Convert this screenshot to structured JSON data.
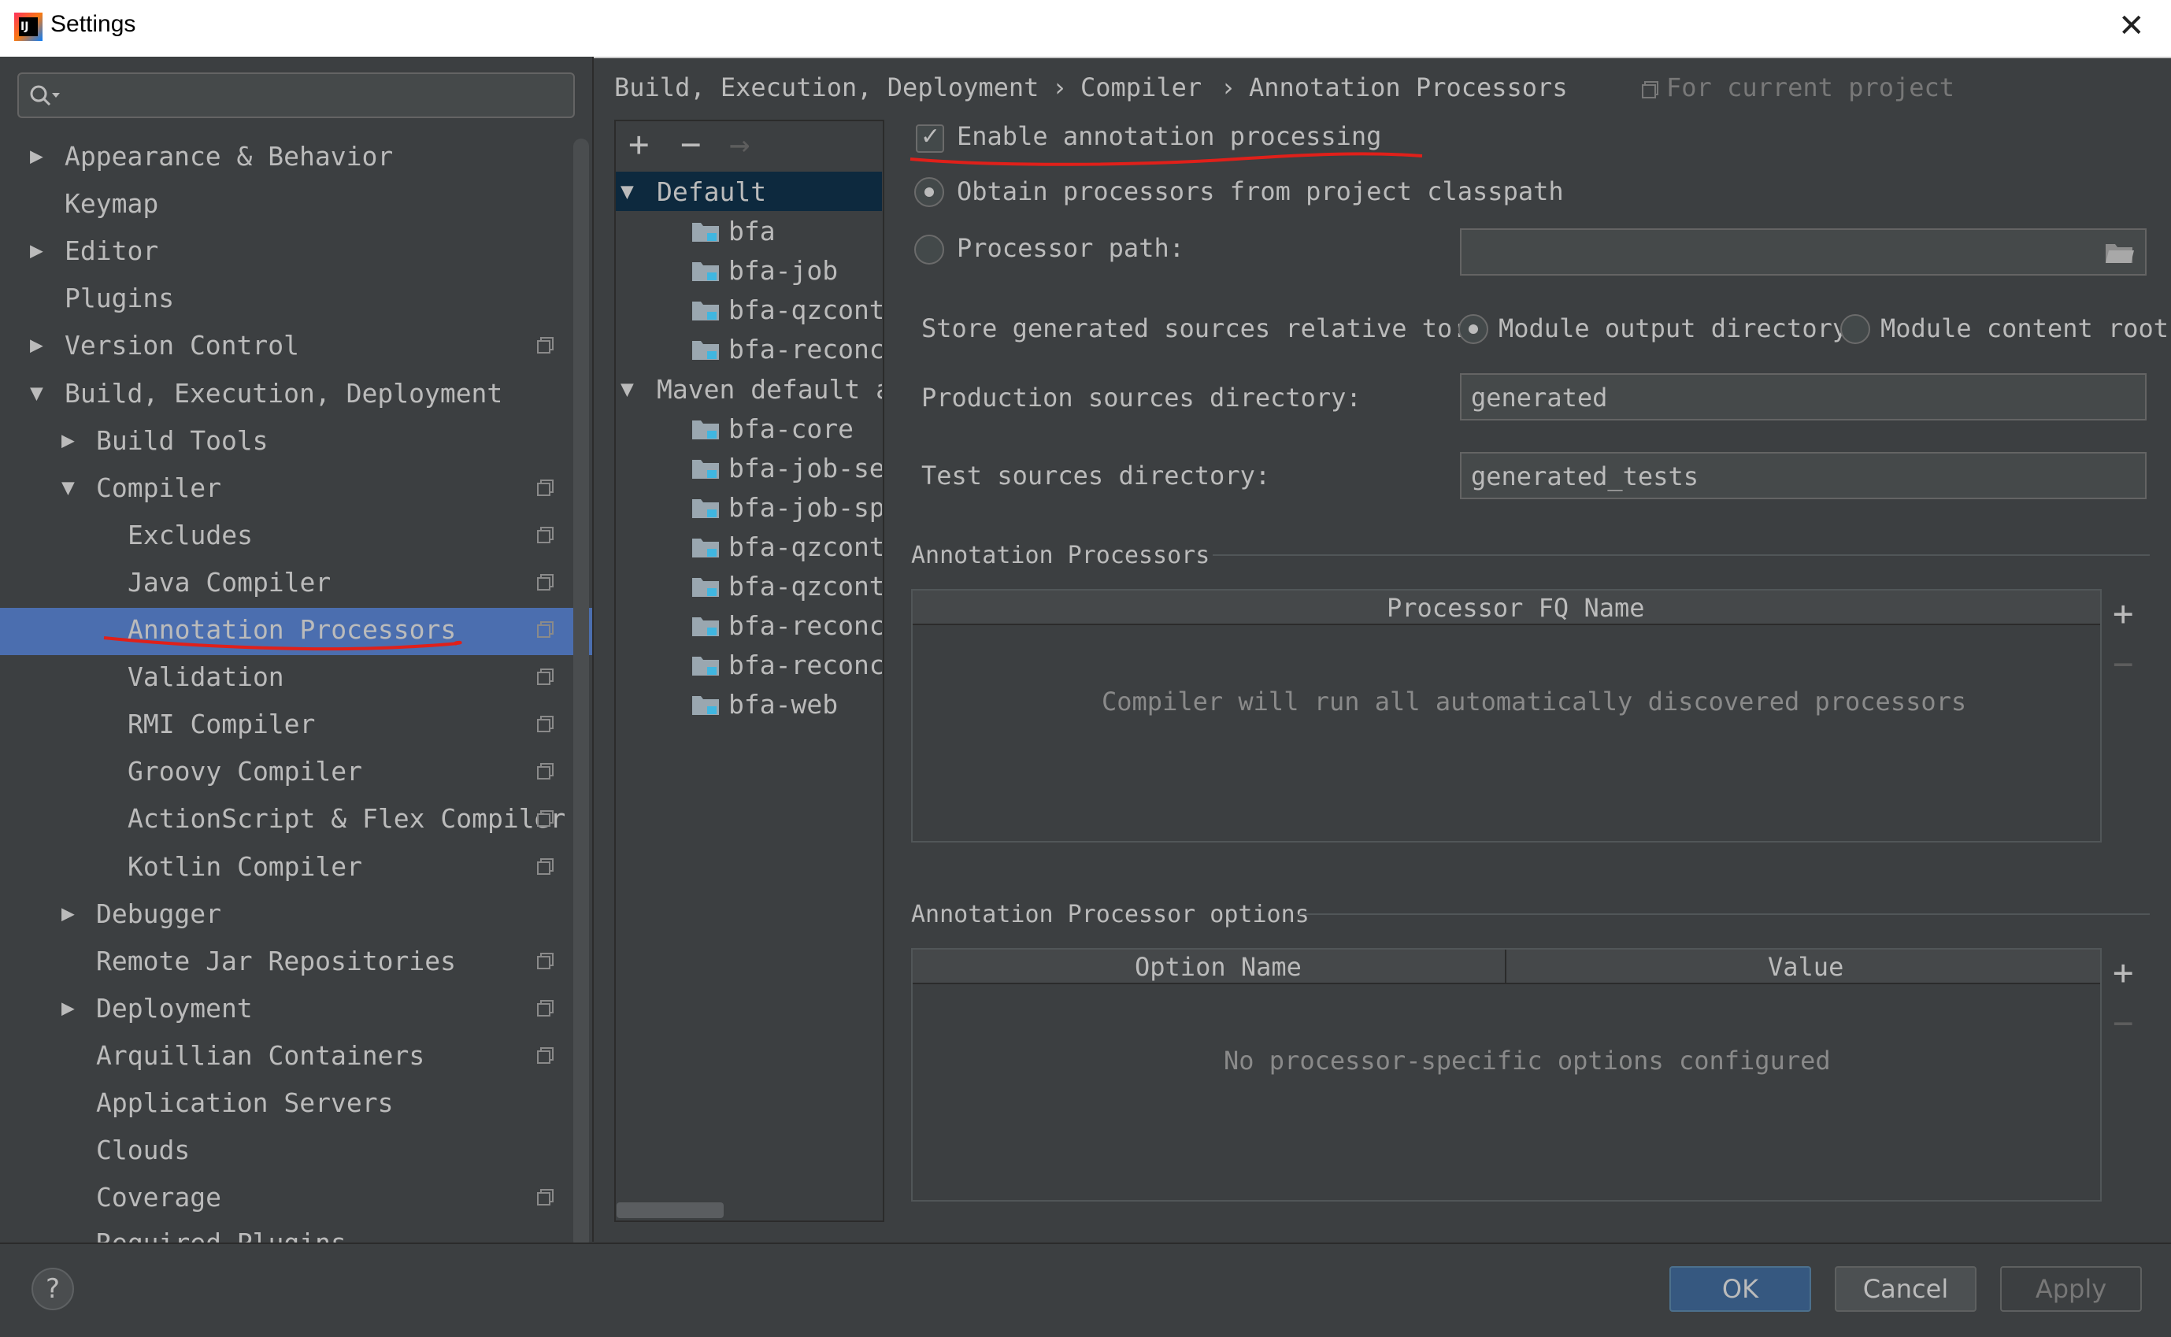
{
  "window": {
    "title": "Settings",
    "close": "✕"
  },
  "search": {
    "placeholder": ""
  },
  "sidebar": {
    "items": [
      {
        "label": "Appearance & Behavior",
        "arrow": "▶"
      },
      {
        "label": "Keymap"
      },
      {
        "label": "Editor",
        "arrow": "▶"
      },
      {
        "label": "Plugins"
      },
      {
        "label": "Version Control",
        "arrow": "▶"
      },
      {
        "label": "Build, Execution, Deployment",
        "arrow": "▼"
      },
      {
        "label": "Build Tools",
        "arrow": "▶"
      },
      {
        "label": "Compiler",
        "arrow": "▼"
      },
      {
        "label": "Excludes"
      },
      {
        "label": "Java Compiler"
      },
      {
        "label": "Annotation Processors"
      },
      {
        "label": "Validation"
      },
      {
        "label": "RMI Compiler"
      },
      {
        "label": "Groovy Compiler"
      },
      {
        "label": "ActionScript & Flex Compiler"
      },
      {
        "label": "Kotlin Compiler"
      },
      {
        "label": "Debugger",
        "arrow": "▶"
      },
      {
        "label": "Remote Jar Repositories"
      },
      {
        "label": "Deployment",
        "arrow": "▶"
      },
      {
        "label": "Arquillian Containers"
      },
      {
        "label": "Application Servers"
      },
      {
        "label": "Clouds"
      },
      {
        "label": "Coverage"
      },
      {
        "label": "Required Plugins"
      }
    ]
  },
  "profiles": {
    "toolbar": {
      "add": "+",
      "remove": "−",
      "move": "→"
    },
    "items": [
      {
        "label": "Default",
        "arrow": "▼"
      },
      {
        "label": "bfa"
      },
      {
        "label": "bfa-job"
      },
      {
        "label": "bfa-qzcontr"
      },
      {
        "label": "bfa-reconci"
      },
      {
        "label": "Maven default an",
        "arrow": "▼"
      },
      {
        "label": "bfa-core"
      },
      {
        "label": "bfa-job-ser"
      },
      {
        "label": "bfa-job-spi"
      },
      {
        "label": "bfa-qzcontr"
      },
      {
        "label": "bfa-qzcontr"
      },
      {
        "label": "bfa-reconci"
      },
      {
        "label": "bfa-reconci"
      },
      {
        "label": "bfa-web"
      }
    ]
  },
  "breadcrumb": {
    "part1": "Build, Execution, Deployment",
    "sep": "›",
    "part2": "Compiler",
    "part3": "Annotation Processors",
    "scope": "For current project"
  },
  "settings": {
    "enable_label": "Enable annotation processing",
    "enable_checked": true,
    "checkmark": "✓",
    "obtain_label": "Obtain processors from project classpath",
    "processor_path_label": "Processor path:",
    "processor_path_value": "",
    "store_label": "Store generated sources relative to:",
    "module_output_label": "Module output directory",
    "module_content_label": "Module content root",
    "production_label": "Production sources directory:",
    "production_value": "generated",
    "test_label": "Test sources directory:",
    "test_value": "generated_tests"
  },
  "processors": {
    "section_title": "Annotation Processors",
    "column": "Processor FQ Name",
    "empty": "Compiler will run all automatically discovered processors",
    "add": "+",
    "remove": "−"
  },
  "options": {
    "section_title": "Annotation Processor options",
    "col_name": "Option Name",
    "col_value": "Value",
    "empty": "No processor-specific options configured",
    "add": "+",
    "remove": "−"
  },
  "footer": {
    "help": "?",
    "ok": "OK",
    "cancel": "Cancel",
    "apply": "Apply"
  },
  "colors": {
    "background": "#3c3f41",
    "selection": "#4b6eaf",
    "annotation_red": "#e0201a"
  }
}
